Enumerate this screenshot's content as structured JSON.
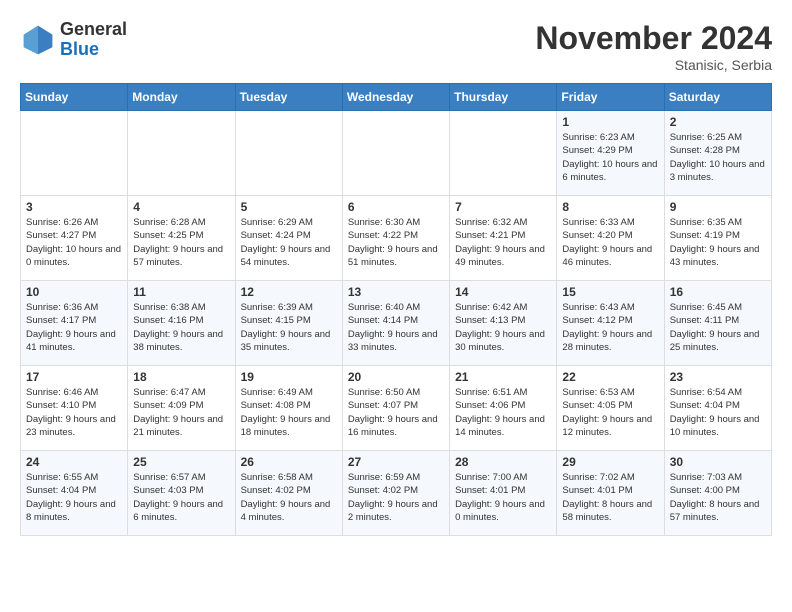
{
  "header": {
    "logo_general": "General",
    "logo_blue": "Blue",
    "month_title": "November 2024",
    "subtitle": "Stanisic, Serbia"
  },
  "weekdays": [
    "Sunday",
    "Monday",
    "Tuesday",
    "Wednesday",
    "Thursday",
    "Friday",
    "Saturday"
  ],
  "weeks": [
    [
      {
        "day": "",
        "info": ""
      },
      {
        "day": "",
        "info": ""
      },
      {
        "day": "",
        "info": ""
      },
      {
        "day": "",
        "info": ""
      },
      {
        "day": "",
        "info": ""
      },
      {
        "day": "1",
        "info": "Sunrise: 6:23 AM\nSunset: 4:29 PM\nDaylight: 10 hours and 6 minutes."
      },
      {
        "day": "2",
        "info": "Sunrise: 6:25 AM\nSunset: 4:28 PM\nDaylight: 10 hours and 3 minutes."
      }
    ],
    [
      {
        "day": "3",
        "info": "Sunrise: 6:26 AM\nSunset: 4:27 PM\nDaylight: 10 hours and 0 minutes."
      },
      {
        "day": "4",
        "info": "Sunrise: 6:28 AM\nSunset: 4:25 PM\nDaylight: 9 hours and 57 minutes."
      },
      {
        "day": "5",
        "info": "Sunrise: 6:29 AM\nSunset: 4:24 PM\nDaylight: 9 hours and 54 minutes."
      },
      {
        "day": "6",
        "info": "Sunrise: 6:30 AM\nSunset: 4:22 PM\nDaylight: 9 hours and 51 minutes."
      },
      {
        "day": "7",
        "info": "Sunrise: 6:32 AM\nSunset: 4:21 PM\nDaylight: 9 hours and 49 minutes."
      },
      {
        "day": "8",
        "info": "Sunrise: 6:33 AM\nSunset: 4:20 PM\nDaylight: 9 hours and 46 minutes."
      },
      {
        "day": "9",
        "info": "Sunrise: 6:35 AM\nSunset: 4:19 PM\nDaylight: 9 hours and 43 minutes."
      }
    ],
    [
      {
        "day": "10",
        "info": "Sunrise: 6:36 AM\nSunset: 4:17 PM\nDaylight: 9 hours and 41 minutes."
      },
      {
        "day": "11",
        "info": "Sunrise: 6:38 AM\nSunset: 4:16 PM\nDaylight: 9 hours and 38 minutes."
      },
      {
        "day": "12",
        "info": "Sunrise: 6:39 AM\nSunset: 4:15 PM\nDaylight: 9 hours and 35 minutes."
      },
      {
        "day": "13",
        "info": "Sunrise: 6:40 AM\nSunset: 4:14 PM\nDaylight: 9 hours and 33 minutes."
      },
      {
        "day": "14",
        "info": "Sunrise: 6:42 AM\nSunset: 4:13 PM\nDaylight: 9 hours and 30 minutes."
      },
      {
        "day": "15",
        "info": "Sunrise: 6:43 AM\nSunset: 4:12 PM\nDaylight: 9 hours and 28 minutes."
      },
      {
        "day": "16",
        "info": "Sunrise: 6:45 AM\nSunset: 4:11 PM\nDaylight: 9 hours and 25 minutes."
      }
    ],
    [
      {
        "day": "17",
        "info": "Sunrise: 6:46 AM\nSunset: 4:10 PM\nDaylight: 9 hours and 23 minutes."
      },
      {
        "day": "18",
        "info": "Sunrise: 6:47 AM\nSunset: 4:09 PM\nDaylight: 9 hours and 21 minutes."
      },
      {
        "day": "19",
        "info": "Sunrise: 6:49 AM\nSunset: 4:08 PM\nDaylight: 9 hours and 18 minutes."
      },
      {
        "day": "20",
        "info": "Sunrise: 6:50 AM\nSunset: 4:07 PM\nDaylight: 9 hours and 16 minutes."
      },
      {
        "day": "21",
        "info": "Sunrise: 6:51 AM\nSunset: 4:06 PM\nDaylight: 9 hours and 14 minutes."
      },
      {
        "day": "22",
        "info": "Sunrise: 6:53 AM\nSunset: 4:05 PM\nDaylight: 9 hours and 12 minutes."
      },
      {
        "day": "23",
        "info": "Sunrise: 6:54 AM\nSunset: 4:04 PM\nDaylight: 9 hours and 10 minutes."
      }
    ],
    [
      {
        "day": "24",
        "info": "Sunrise: 6:55 AM\nSunset: 4:04 PM\nDaylight: 9 hours and 8 minutes."
      },
      {
        "day": "25",
        "info": "Sunrise: 6:57 AM\nSunset: 4:03 PM\nDaylight: 9 hours and 6 minutes."
      },
      {
        "day": "26",
        "info": "Sunrise: 6:58 AM\nSunset: 4:02 PM\nDaylight: 9 hours and 4 minutes."
      },
      {
        "day": "27",
        "info": "Sunrise: 6:59 AM\nSunset: 4:02 PM\nDaylight: 9 hours and 2 minutes."
      },
      {
        "day": "28",
        "info": "Sunrise: 7:00 AM\nSunset: 4:01 PM\nDaylight: 9 hours and 0 minutes."
      },
      {
        "day": "29",
        "info": "Sunrise: 7:02 AM\nSunset: 4:01 PM\nDaylight: 8 hours and 58 minutes."
      },
      {
        "day": "30",
        "info": "Sunrise: 7:03 AM\nSunset: 4:00 PM\nDaylight: 8 hours and 57 minutes."
      }
    ]
  ]
}
